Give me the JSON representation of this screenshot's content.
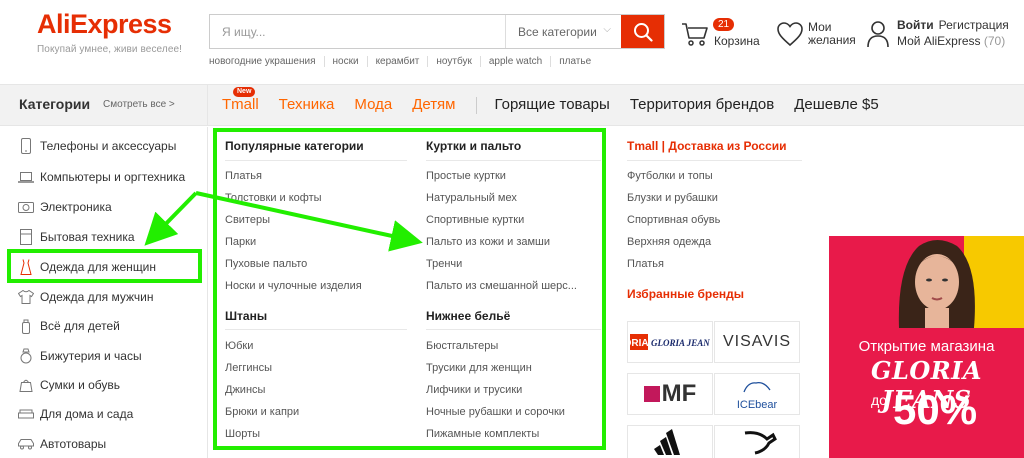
{
  "header": {
    "logo_text": "AliExpress",
    "logo_tagline": "Покупай умнее, живи веселее!",
    "search_placeholder": "Я ищу...",
    "search_category": "Все категории",
    "hot_searches": [
      "новогодние украшения",
      "носки",
      "керамбит",
      "ноутбук",
      "apple watch",
      "платье"
    ],
    "cart_count": "21",
    "cart_label": "Корзина",
    "wishlist_label": "Мои желания",
    "login_label": "Войти",
    "register_label": "Регистрация",
    "my_account_label": "Мой AliExpress",
    "my_account_count": "(70)"
  },
  "nav": {
    "categories_title": "Категории",
    "see_all": "Смотреть все >",
    "new_badge": "New",
    "links_orange": [
      "Tmall",
      "Техника",
      "Мода",
      "Детям"
    ],
    "links_dark": [
      "Горящие товары",
      "Территория брендов",
      "Дешевле $5"
    ]
  },
  "sidebar": {
    "items": [
      {
        "label": "Телефоны и аксессуары",
        "icon": "phone-icon"
      },
      {
        "label": "Компьютеры и оргтехника",
        "icon": "laptop-icon"
      },
      {
        "label": "Электроника",
        "icon": "camera-icon"
      },
      {
        "label": "Бытовая техника",
        "icon": "appliance-icon"
      },
      {
        "label": "Одежда для женщин",
        "icon": "dress-icon"
      },
      {
        "label": "Одежда для мужчин",
        "icon": "shirt-icon"
      },
      {
        "label": "Всё для детей",
        "icon": "baby-bottle-icon"
      },
      {
        "label": "Бижутерия и часы",
        "icon": "ring-icon"
      },
      {
        "label": "Сумки и обувь",
        "icon": "bag-icon"
      },
      {
        "label": "Для дома и сада",
        "icon": "sofa-icon"
      },
      {
        "label": "Автотовары",
        "icon": "car-icon"
      }
    ]
  },
  "panel": {
    "col1": {
      "heading1": "Популярные категории",
      "links1": [
        "Платья",
        "Толстовки и кофты",
        "Свитеры",
        "Парки",
        "Пуховые пальто",
        "Носки и чулочные изделия"
      ],
      "heading2": "Штаны",
      "links2": [
        "Юбки",
        "Леггинсы",
        "Джинсы",
        "Брюки и капри",
        "Шорты"
      ]
    },
    "col2": {
      "heading1": "Куртки и пальто",
      "links1": [
        "Простые куртки",
        "Натуральный мех",
        "Спортивные куртки",
        "Пальто из кожи и замши",
        "Тренчи",
        "Пальто из смешанной шерс..."
      ],
      "heading2": "Нижнее бельё",
      "links2": [
        "Бюстгальтеры",
        "Трусики для женщин",
        "Лифчики и трусики",
        "Ночные рубашки и сорочки",
        "Пижамные комплекты"
      ]
    },
    "col3": {
      "heading1": "Tmall | Доставка из России",
      "links1": [
        "Футболки и топы",
        "Блузки и рубашки",
        "Спортивная обувь",
        "Верхняя одежда",
        "Платья"
      ],
      "heading2": "Избранные бренды",
      "brands": [
        "GJ GLORIA JEANS",
        "VISAVIS",
        "MF",
        "ICEbear",
        "adidas",
        "PUMA"
      ]
    },
    "banner": {
      "line1": "Открытие магазина",
      "line2": "GLORIA JEANS",
      "line3": "до",
      "line4": "50%"
    }
  },
  "colors": {
    "brand_red": "#e62e04",
    "nav_orange": "#ff6600",
    "annotation_green": "#22ee00"
  }
}
